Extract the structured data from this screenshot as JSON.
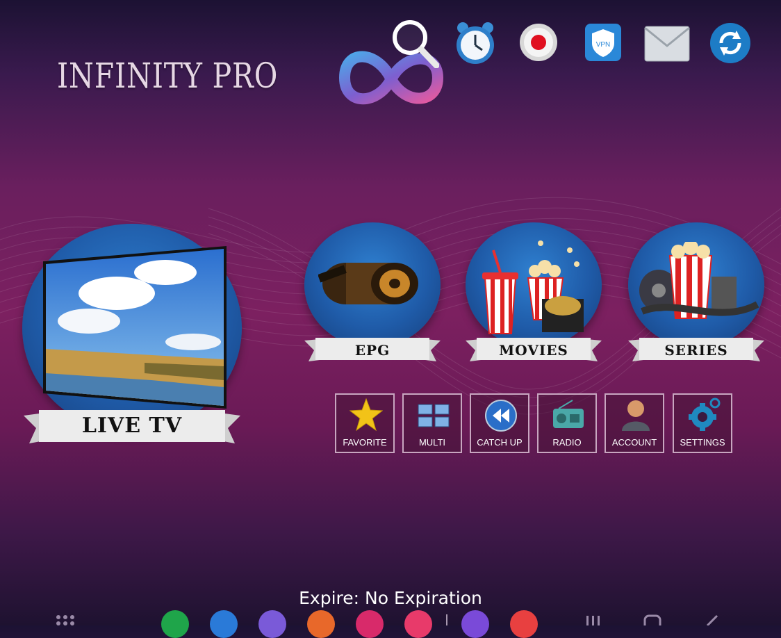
{
  "app": {
    "title": "INFINITY PRO"
  },
  "top_icons": [
    {
      "name": "search-icon"
    },
    {
      "name": "alarm-clock-icon"
    },
    {
      "name": "record-icon"
    },
    {
      "name": "vpn-icon",
      "text": "VPN"
    },
    {
      "name": "mail-icon"
    },
    {
      "name": "refresh-icon"
    }
  ],
  "main": {
    "live_tv": {
      "label": "LIVE TV"
    },
    "epg": {
      "label": "EPG"
    },
    "movies": {
      "label": "MOVIES"
    },
    "series": {
      "label": "SERIES"
    }
  },
  "tiles": [
    {
      "label": "FAVORITE",
      "icon": "star-icon"
    },
    {
      "label": "MULTI",
      "icon": "multi-screen-icon"
    },
    {
      "label": "CATCH UP",
      "icon": "rewind-icon"
    },
    {
      "label": "RADIO",
      "icon": "radio-icon"
    },
    {
      "label": "ACCOUNT",
      "icon": "user-icon"
    },
    {
      "label": "SETTINGS",
      "icon": "gear-icon"
    }
  ],
  "status": {
    "expire": "Expire: No Expiration"
  },
  "colors": {
    "accent_blue": "#1f5ba8",
    "tile_border": "#c8a6c0",
    "background": "#7c2060"
  }
}
